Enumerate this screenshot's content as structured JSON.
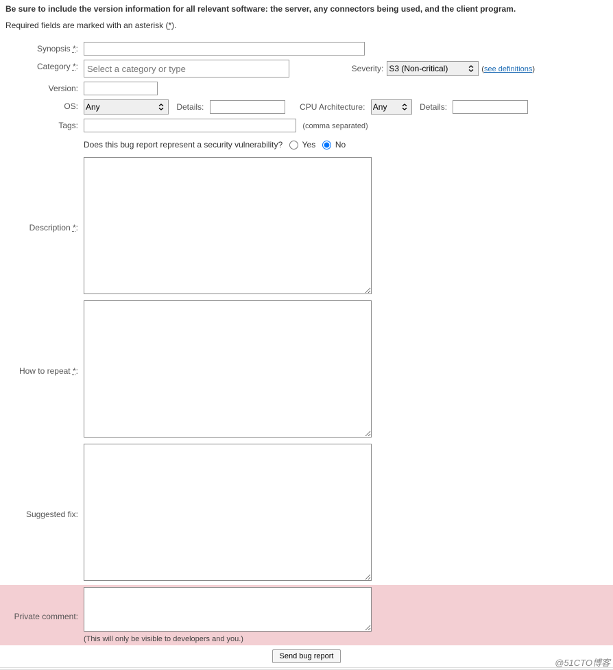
{
  "notices": {
    "version_info": "Be sure to include the version information for all relevant software: the server, any connectors being used, and the client program.",
    "required_prefix": "Required fields are marked with an asterisk (",
    "required_asterisk": "*",
    "required_suffix": ")."
  },
  "labels": {
    "synopsis": "Synopsis ",
    "category": "Category ",
    "severity": "Severity:",
    "version": "Version:",
    "os": "OS:",
    "details": "Details:",
    "cpu": "CPU Architecture:",
    "tags": "Tags:",
    "description": "Description ",
    "how_to_repeat": "How to repeat ",
    "suggested_fix": "Suggested fix:",
    "private_comment": "Private comment:",
    "asterisk_colon": ":"
  },
  "fields": {
    "synopsis": "",
    "category_placeholder": "Select a category or type",
    "category_value": "",
    "severity_selected": "S3 (Non-critical)",
    "see_definitions": "see definitions",
    "version": "",
    "os_selected": "Any",
    "os_details": "",
    "cpu_selected": "Any",
    "cpu_details": "",
    "tags": "",
    "tags_hint": "(comma separated)",
    "security_question": "Does this bug report represent a security vulnerability?",
    "yes": "Yes",
    "no": "No",
    "security_value": "No",
    "description": "",
    "how_to_repeat": "",
    "suggested_fix": "",
    "private_comment": "",
    "private_hint": "(This will only be visible to developers and you.)"
  },
  "submit": {
    "label": "Send bug report"
  },
  "watermark": "@51CTO博客"
}
